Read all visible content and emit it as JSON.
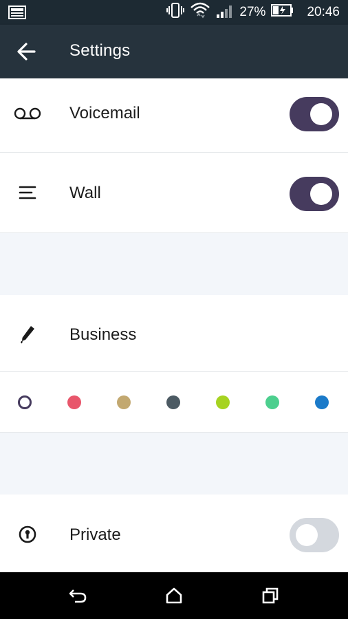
{
  "status_bar": {
    "battery_percent": "27%",
    "time": "20:46",
    "icons": [
      "gallery-icon",
      "vibrate-icon",
      "wifi-icon",
      "signal-icon",
      "battery-charging-icon"
    ]
  },
  "app_bar": {
    "title": "Settings",
    "back_icon": "arrow-back-icon"
  },
  "settings": {
    "voicemail": {
      "label": "Voicemail",
      "icon": "voicemail-icon",
      "enabled": true
    },
    "wall": {
      "label": "Wall",
      "icon": "menu-lines-icon",
      "enabled": true
    },
    "business": {
      "label": "Business",
      "icon": "pencil-icon"
    },
    "private": {
      "label": "Private",
      "icon": "keyhole-lock-icon",
      "enabled": false
    }
  },
  "colors": {
    "selected_index": 0,
    "options": [
      "#ffffff",
      "#e8566b",
      "#c2a870",
      "#4c5a63",
      "#a6d321",
      "#4ccf8e",
      "#1b7ac9"
    ]
  },
  "theme": {
    "accent": "#463b5e",
    "appbar": "#26333d",
    "statusbar": "#1d2a33",
    "spacer": "#f3f6fa",
    "toggle_off": "#d4d8de"
  },
  "nav_bar": {
    "icons": [
      "back-nav-icon",
      "home-nav-icon",
      "recents-nav-icon"
    ]
  }
}
